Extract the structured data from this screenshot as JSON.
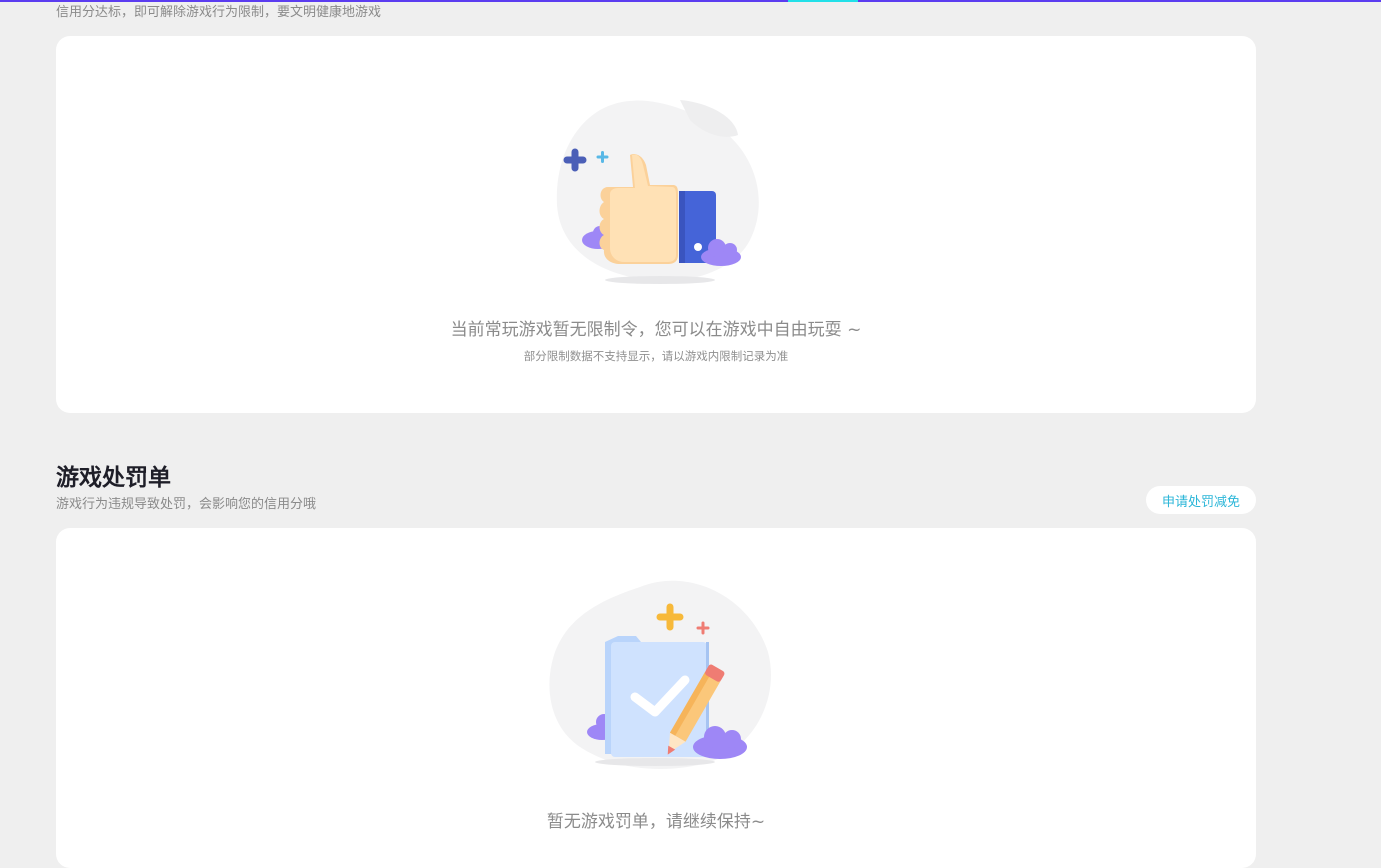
{
  "restriction_section": {
    "description": "信用分达标，即可解除游戏行为限制，要文明健康地游戏",
    "empty_state": {
      "illustration": "thumbs-up-icon",
      "message": "当前常玩游戏暂无限制令，您可以在游戏中自由玩耍 ~",
      "note": "部分限制数据不支持显示，请以游戏内限制记录为准"
    }
  },
  "penalty_section": {
    "title": "游戏处罚单",
    "description": "游戏行为违规导致处罚，会影响您的信用分哦",
    "appeal_button": "申请处罚减免",
    "empty_state": {
      "illustration": "clipboard-pencil-icon",
      "message": "暂无游戏罚单，请继续保持~"
    }
  },
  "colors": {
    "background": "#efefef",
    "card": "#ffffff",
    "accent": "#2bb6d8",
    "top_bar": "#5b3cf0",
    "top_bar_highlight": "#22e0e8"
  }
}
